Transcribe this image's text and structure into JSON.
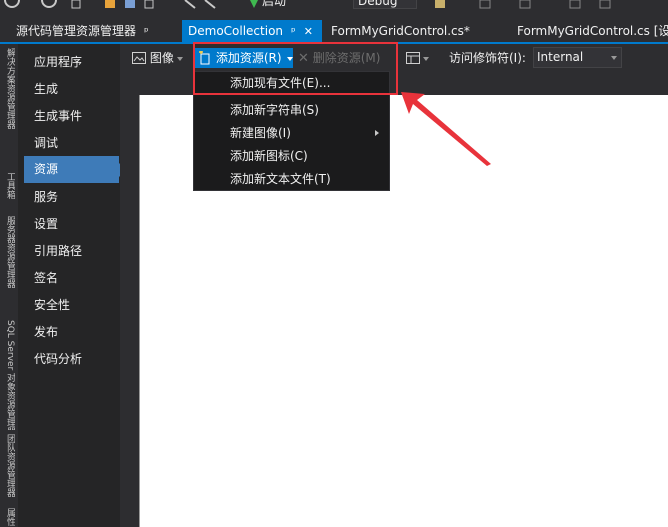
{
  "topbar": {
    "run_label": "启动",
    "config_value": "Debug"
  },
  "tabs": [
    {
      "label": "源代码管理资源管理器",
      "pin": "ᵖ"
    },
    {
      "label": "DemoCollection",
      "pin": "ᵖ",
      "close": "✕"
    },
    {
      "label": "FormMyGridControl.cs*"
    },
    {
      "label": "FormMyGridControl.cs [设"
    }
  ],
  "left_strip": [
    "解决方案资源管理器",
    "工具箱",
    "服务器资源管理器",
    "SQL Server 对象资源管理器",
    "团队资源管理器",
    "属性"
  ],
  "nav": {
    "items": [
      "应用程序",
      "生成",
      "生成事件",
      "调试",
      "资源",
      "服务",
      "设置",
      "引用路径",
      "签名",
      "安全性",
      "发布",
      "代码分析"
    ],
    "selected_index": 4
  },
  "resource_toolbar": {
    "image_label": "图像",
    "add_resource_label": "添加资源(R)",
    "remove_resource_label": "删除资源(M)",
    "access_modifier_label": "访问修饰符(I):",
    "access_modifier_value": "Internal"
  },
  "menu": {
    "items": [
      {
        "label": "添加现有文件(E)...",
        "submenu": false
      },
      {
        "label": "添加新字符串(S)",
        "submenu": false
      },
      {
        "label": "新建图像(I)",
        "submenu": true
      },
      {
        "label": "添加新图标(C)",
        "submenu": false
      },
      {
        "label": "添加新文本文件(T)",
        "submenu": false
      }
    ]
  },
  "colors": {
    "accent": "#007acc",
    "highlight_red": "#e8333b",
    "nav_selected": "#3e7bb8"
  }
}
